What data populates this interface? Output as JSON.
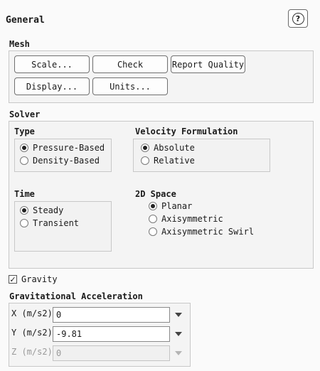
{
  "panel": {
    "title": "General",
    "help_glyph": "?"
  },
  "mesh": {
    "label": "Mesh",
    "buttons": {
      "scale": "Scale...",
      "check": "Check",
      "report_quality": "Report Quality",
      "display": "Display...",
      "units": "Units..."
    }
  },
  "solver": {
    "label": "Solver",
    "type": {
      "label": "Type",
      "options": [
        "Pressure-Based",
        "Density-Based"
      ],
      "selected": "Pressure-Based"
    },
    "velocity": {
      "label": "Velocity Formulation",
      "options": [
        "Absolute",
        "Relative"
      ],
      "selected": "Absolute"
    },
    "time": {
      "label": "Time",
      "options": [
        "Steady",
        "Transient"
      ],
      "selected": "Steady"
    },
    "space2d": {
      "label": "2D Space",
      "options": [
        "Planar",
        "Axisymmetric",
        "Axisymmetric Swirl"
      ],
      "selected": "Planar"
    }
  },
  "gravity": {
    "label": "Gravity",
    "checked": true,
    "check_glyph": "✓"
  },
  "grav_accel": {
    "label": "Gravitational Acceleration",
    "x": {
      "label": "X (m/s2)",
      "value": "0"
    },
    "y": {
      "label": "Y (m/s2)",
      "value": "-9.81"
    },
    "z": {
      "label": "Z (m/s2)",
      "value": "0"
    }
  },
  "colors": {
    "panel_bg": "#fafafa",
    "group_bg": "#f4f4f4",
    "border": "#c8c8c8",
    "disabled_text": "#9a9a9a"
  }
}
